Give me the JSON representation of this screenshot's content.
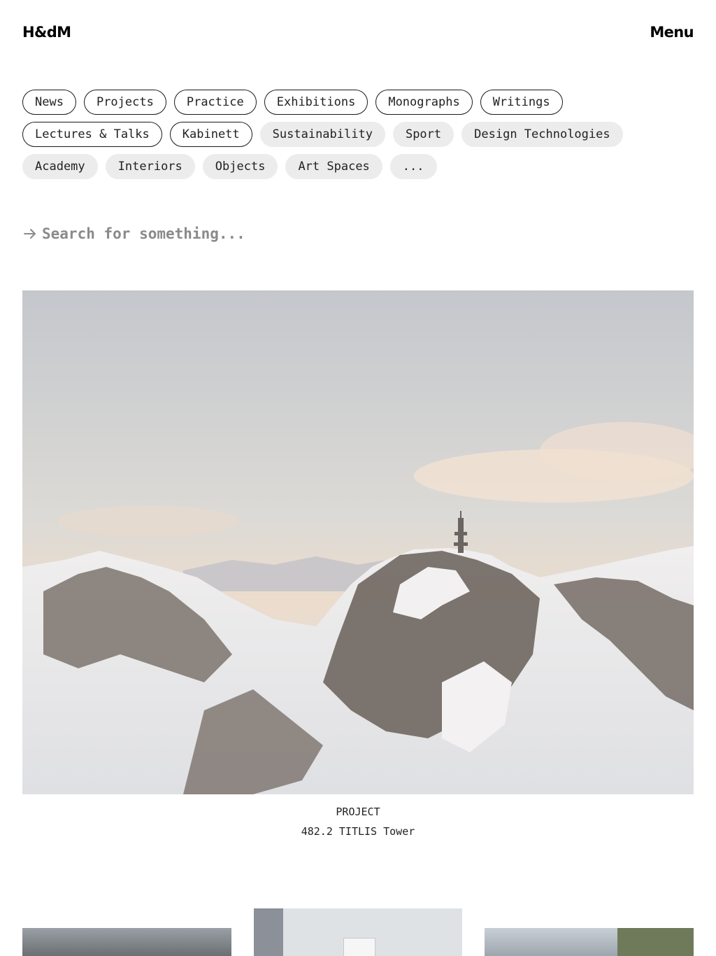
{
  "header": {
    "logo": "H&dM",
    "menu_label": "Menu"
  },
  "filters": {
    "rows": [
      [
        {
          "label": "News",
          "style": "outline"
        },
        {
          "label": "Projects",
          "style": "outline"
        },
        {
          "label": "Practice",
          "style": "outline"
        },
        {
          "label": "Exhibitions",
          "style": "outline"
        },
        {
          "label": "Monographs",
          "style": "outline"
        },
        {
          "label": "Writings",
          "style": "outline"
        }
      ],
      [
        {
          "label": "Lectures & Talks",
          "style": "outline"
        },
        {
          "label": "Kabinett",
          "style": "outline"
        },
        {
          "label": "Sustainability",
          "style": "fill"
        },
        {
          "label": "Sport",
          "style": "fill"
        },
        {
          "label": "Design Technologies",
          "style": "fill"
        }
      ],
      [
        {
          "label": "Academy",
          "style": "fill"
        },
        {
          "label": "Interiors",
          "style": "fill"
        },
        {
          "label": "Objects",
          "style": "fill"
        },
        {
          "label": "Art Spaces",
          "style": "fill"
        },
        {
          "label": "...",
          "style": "fill"
        }
      ]
    ]
  },
  "search": {
    "icon": "arrow-right-icon",
    "placeholder": "Search for something..."
  },
  "featured": {
    "category": "PROJECT",
    "title": "482.2 TITLIS Tower"
  },
  "thumbnails": [
    "thumbnail-1",
    "thumbnail-2",
    "thumbnail-3"
  ]
}
